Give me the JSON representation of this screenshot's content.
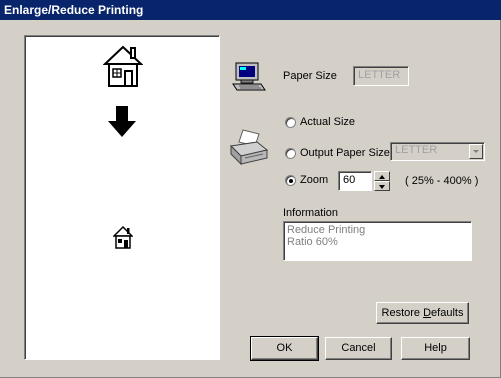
{
  "window": {
    "title": "Enlarge/Reduce Printing"
  },
  "icons": {
    "preview_house_large": "house-icon",
    "preview_arrow": "arrow-down-icon",
    "preview_house_small": "house-icon",
    "computer": "computer-icon",
    "printer": "printer-icon"
  },
  "paper_size": {
    "label": "Paper Size",
    "value": "LETTER"
  },
  "options": {
    "actual_size": {
      "label": "Actual Size",
      "selected": false
    },
    "output_paper_size": {
      "label": "Output Paper Size",
      "selected": false,
      "value": "LETTER"
    },
    "zoom": {
      "label": "Zoom",
      "selected": true,
      "value": "60",
      "range_note": "( 25% - 400% )"
    }
  },
  "information": {
    "label": "Information",
    "line1": "Reduce Printing",
    "line2": "Ratio 60%"
  },
  "buttons": {
    "restore_defaults": {
      "prefix": "Restore ",
      "underline": "D",
      "suffix": "efaults"
    },
    "ok": "OK",
    "cancel": "Cancel",
    "help": "Help"
  },
  "colors": {
    "titlebar": "#08246b",
    "face": "#d4d0c8",
    "disabled_text": "#a0a0a0"
  }
}
